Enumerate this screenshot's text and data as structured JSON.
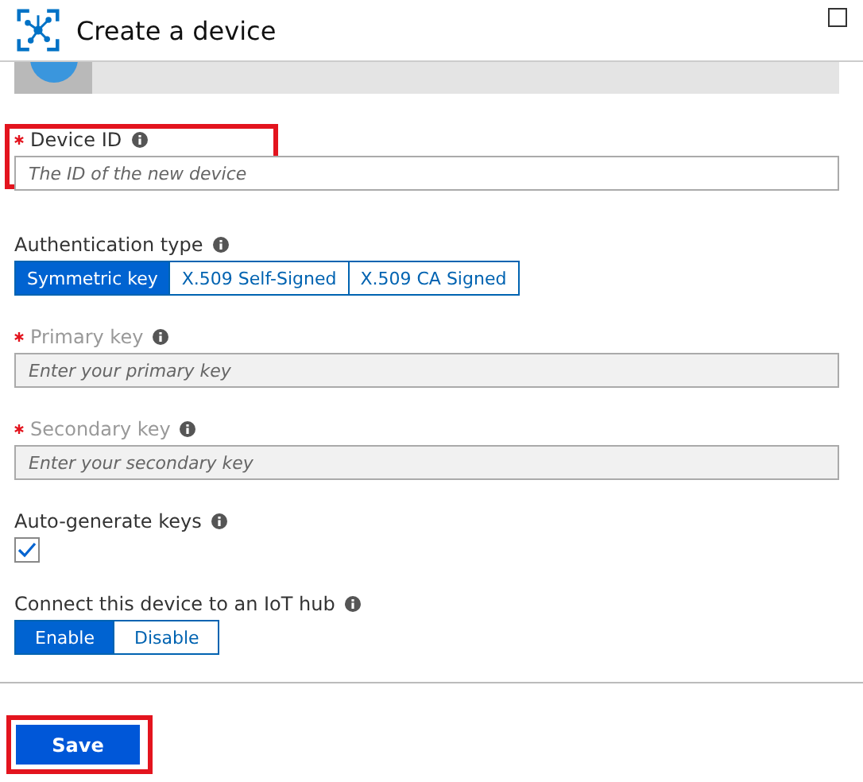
{
  "window": {
    "title": "Create a device"
  },
  "device_id": {
    "label": "Device ID",
    "required": true,
    "placeholder": "The ID of the new device",
    "highlighted": true
  },
  "authentication_type": {
    "label": "Authentication type",
    "options": [
      {
        "label": "Symmetric key",
        "selected": true
      },
      {
        "label": "X.509 Self-Signed",
        "selected": false
      },
      {
        "label": "X.509 CA Signed",
        "selected": false
      }
    ]
  },
  "primary_key": {
    "label": "Primary key",
    "required": true,
    "disabled": true,
    "placeholder": "Enter your primary key"
  },
  "secondary_key": {
    "label": "Secondary key",
    "required": true,
    "disabled": true,
    "placeholder": "Enter your secondary key"
  },
  "auto_generate_keys": {
    "label": "Auto-generate keys",
    "checked": true
  },
  "connect_iot_hub": {
    "label": "Connect this device to an IoT hub",
    "options": [
      {
        "label": "Enable",
        "selected": true
      },
      {
        "label": "Disable",
        "selected": false
      }
    ]
  },
  "save_button": {
    "label": "Save",
    "highlighted": true
  }
}
